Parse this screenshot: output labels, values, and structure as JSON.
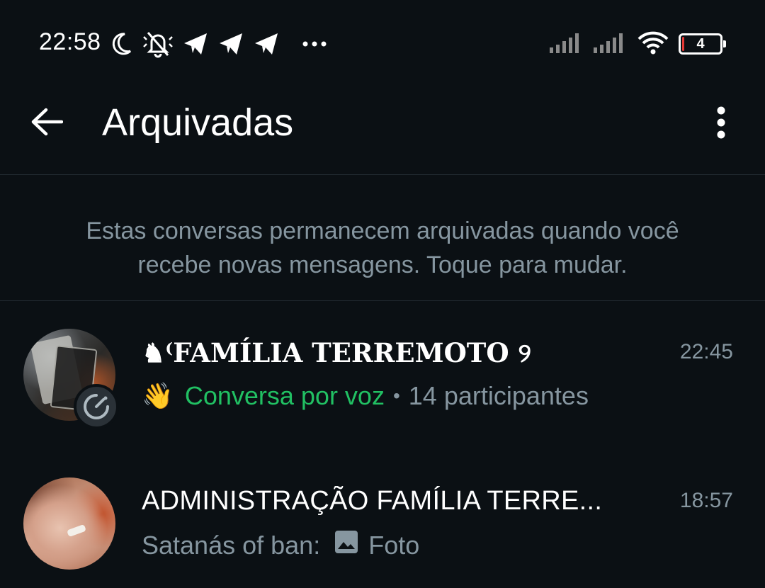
{
  "status_bar": {
    "time": "22:58",
    "battery_level": "4",
    "icons": [
      "moon-icon",
      "muted-bell-icon",
      "telegram-icon",
      "telegram-icon",
      "telegram-icon",
      "more-notifications-icon",
      "signal-icon",
      "signal-icon",
      "wifi-icon",
      "battery-icon"
    ]
  },
  "app_bar": {
    "title": "Arquivadas",
    "back_icon": "arrow-back-icon",
    "menu_icon": "more-vert-icon"
  },
  "info": {
    "line1": "Estas conversas permanecem arquivadas quando você",
    "line2": "recebe novas mensagens. Toque para mudar."
  },
  "chats": [
    {
      "name": "♞⁽FAMÍLIA TERREMOTO ୨",
      "time": "22:45",
      "preview_emoji": "👋",
      "preview_voice": "Conversa por voz",
      "preview_separator": "•",
      "preview_rest": "14 participantes",
      "badge_icon": "voice-chat-icon"
    },
    {
      "name": "ADMINISTRAÇÃO FAMÍLIA TERRE...",
      "time": "18:57",
      "preview_sender": "Satanás of ban:",
      "preview_media_icon": "photo-icon",
      "preview_text": "Foto"
    }
  ],
  "colors": {
    "background": "#0b1014",
    "accent_green": "#21c063",
    "secondary_text": "#8696a0",
    "primary_text": "#ffffff"
  }
}
